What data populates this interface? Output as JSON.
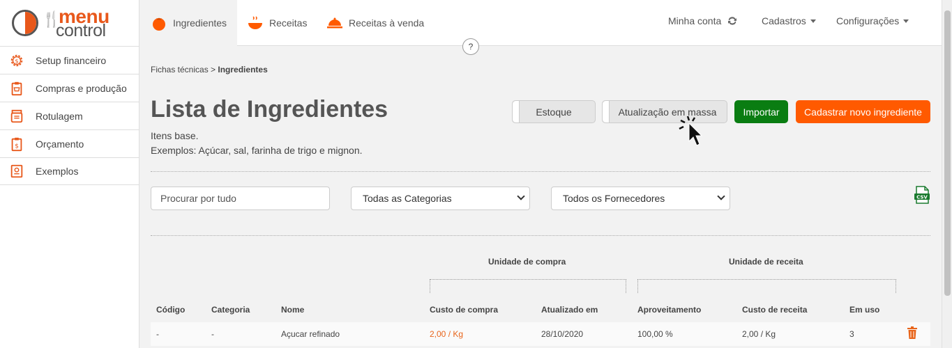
{
  "app": {
    "logo_menu": "menu",
    "logo_control": "control"
  },
  "sidebar": {
    "items": [
      {
        "label": "Setup financeiro",
        "icon": "gear-dollar-icon"
      },
      {
        "label": "Compras e produção",
        "icon": "clipboard-cart-icon"
      },
      {
        "label": "Rotulagem",
        "icon": "jar-label-icon"
      },
      {
        "label": "Orçamento",
        "icon": "clipboard-dollar-icon"
      },
      {
        "label": "Exemplos",
        "icon": "book-icon"
      }
    ]
  },
  "topnav": {
    "tabs": [
      {
        "label": "Ingredientes",
        "icon": "tomato-icon",
        "active": true
      },
      {
        "label": "Receitas",
        "icon": "bowl-icon",
        "active": false
      },
      {
        "label": "Receitas à venda",
        "icon": "cloche-icon",
        "active": false
      }
    ],
    "account": "Minha conta",
    "cadastros": "Cadastros",
    "config": "Configurações",
    "help": "?"
  },
  "breadcrumb": {
    "parent": "Fichas técnicas",
    "sep": " > ",
    "current": "Ingredientes"
  },
  "page": {
    "title": "Lista de Ingredientes",
    "desc1": "Itens base.",
    "desc2": "Exemplos: Açúcar, sal, farinha de trigo e mignon."
  },
  "actions": {
    "estoque": "Estoque",
    "mass_update": "Atualização em massa",
    "import": "Importar",
    "new": "Cadastrar novo ingrediente"
  },
  "filters": {
    "search_placeholder": "Procurar por tudo",
    "category": "Todas as Categorias",
    "supplier": "Todos os Fornecedores",
    "export_icon": "csv-file-icon"
  },
  "table": {
    "group_purchase": "Unidade de compra",
    "group_recipe": "Unidade de receita",
    "headers": [
      "Código",
      "Categoria",
      "Nome",
      "Custo de compra",
      "Atualizado em",
      "Aproveitamento",
      "Custo de receita",
      "Em uso"
    ],
    "rows": [
      [
        "-",
        "-",
        "Açucar refinado",
        "2,00 / Kg",
        "28/10/2020",
        "100,00 %",
        "2,00 / Kg",
        "3"
      ]
    ]
  },
  "colors": {
    "accent": "#ff5a00",
    "green": "#0a7d12",
    "link_orange": "#e8641a"
  }
}
